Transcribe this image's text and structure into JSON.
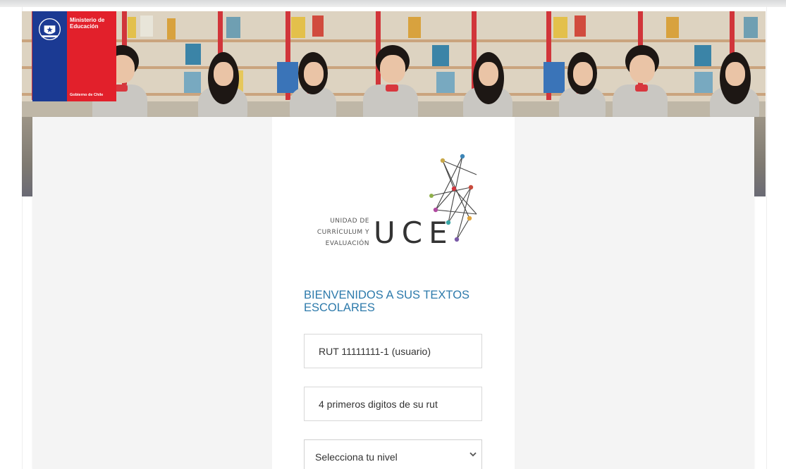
{
  "header": {
    "ministry_title": "Ministerio de Educación",
    "government_label": "Gobierno de Chile",
    "logo_colors": {
      "blue": "#1b3a93",
      "red": "#e2202b"
    },
    "banner_image": "classroom-children-photo"
  },
  "uce_logo": {
    "line1": "UNIDAD DE",
    "line2": "CURRÍCULUM Y",
    "line3": "EVALUACIÓN",
    "acronym": "UCE",
    "icon": "network-nodes-icon"
  },
  "login": {
    "welcome_title": "BIENVENIDOS A SUS TEXTOS ESCOLARES",
    "rut_placeholder": "RUT 11111111-1 (usuario)",
    "pin_placeholder": "4 primeros digitos de su rut",
    "level_select_value": "Selecciona tu nivel",
    "accent_color": "#2d7aab"
  }
}
